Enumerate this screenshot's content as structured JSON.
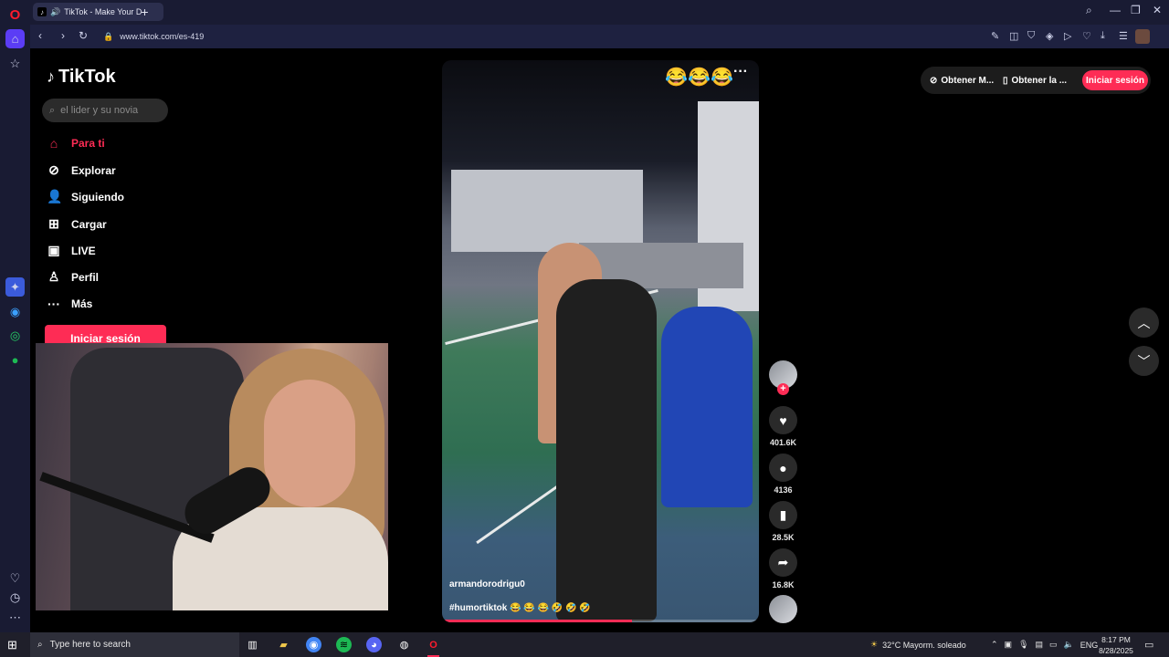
{
  "browser": {
    "tab_title": "TikTok - Make Your D",
    "url": "www.tiktok.com/es-419"
  },
  "tiktok": {
    "logo_text": "TikTok",
    "search_placeholder": "el lider y su novia",
    "menu": [
      {
        "label": "Para ti",
        "icon": "home-icon"
      },
      {
        "label": "Explorar",
        "icon": "compass-icon"
      },
      {
        "label": "Siguiendo",
        "icon": "following-icon"
      },
      {
        "label": "Cargar",
        "icon": "upload-icon"
      },
      {
        "label": "LIVE",
        "icon": "live-icon"
      },
      {
        "label": "Perfil",
        "icon": "profile-icon"
      },
      {
        "label": "Más",
        "icon": "more-icon"
      }
    ],
    "login_button": "Iniciar sesión",
    "top_right": {
      "get_app_1": "Obtener M...",
      "get_app_2": "Obtener la ...",
      "login": "Iniciar sesión"
    },
    "video": {
      "overlay_emoji": "😂😂😂",
      "username": "armandorodrigu0",
      "hashtags": "#humortiktok 😂 😂 😂 🤣 🤣 🤣",
      "progress": 0.6
    },
    "actions": {
      "likes": "401.6K",
      "comments": "4136",
      "saves": "28.5K",
      "shares": "16.8K"
    }
  },
  "taskbar": {
    "search_placeholder": "Type here to search",
    "weather": "32°C  Mayorm. soleado",
    "lang": "ENG",
    "time": "8:17 PM",
    "date": "8/28/2025"
  },
  "colors": {
    "accent": "#fe2c55",
    "opera_bg": "#191b33"
  }
}
